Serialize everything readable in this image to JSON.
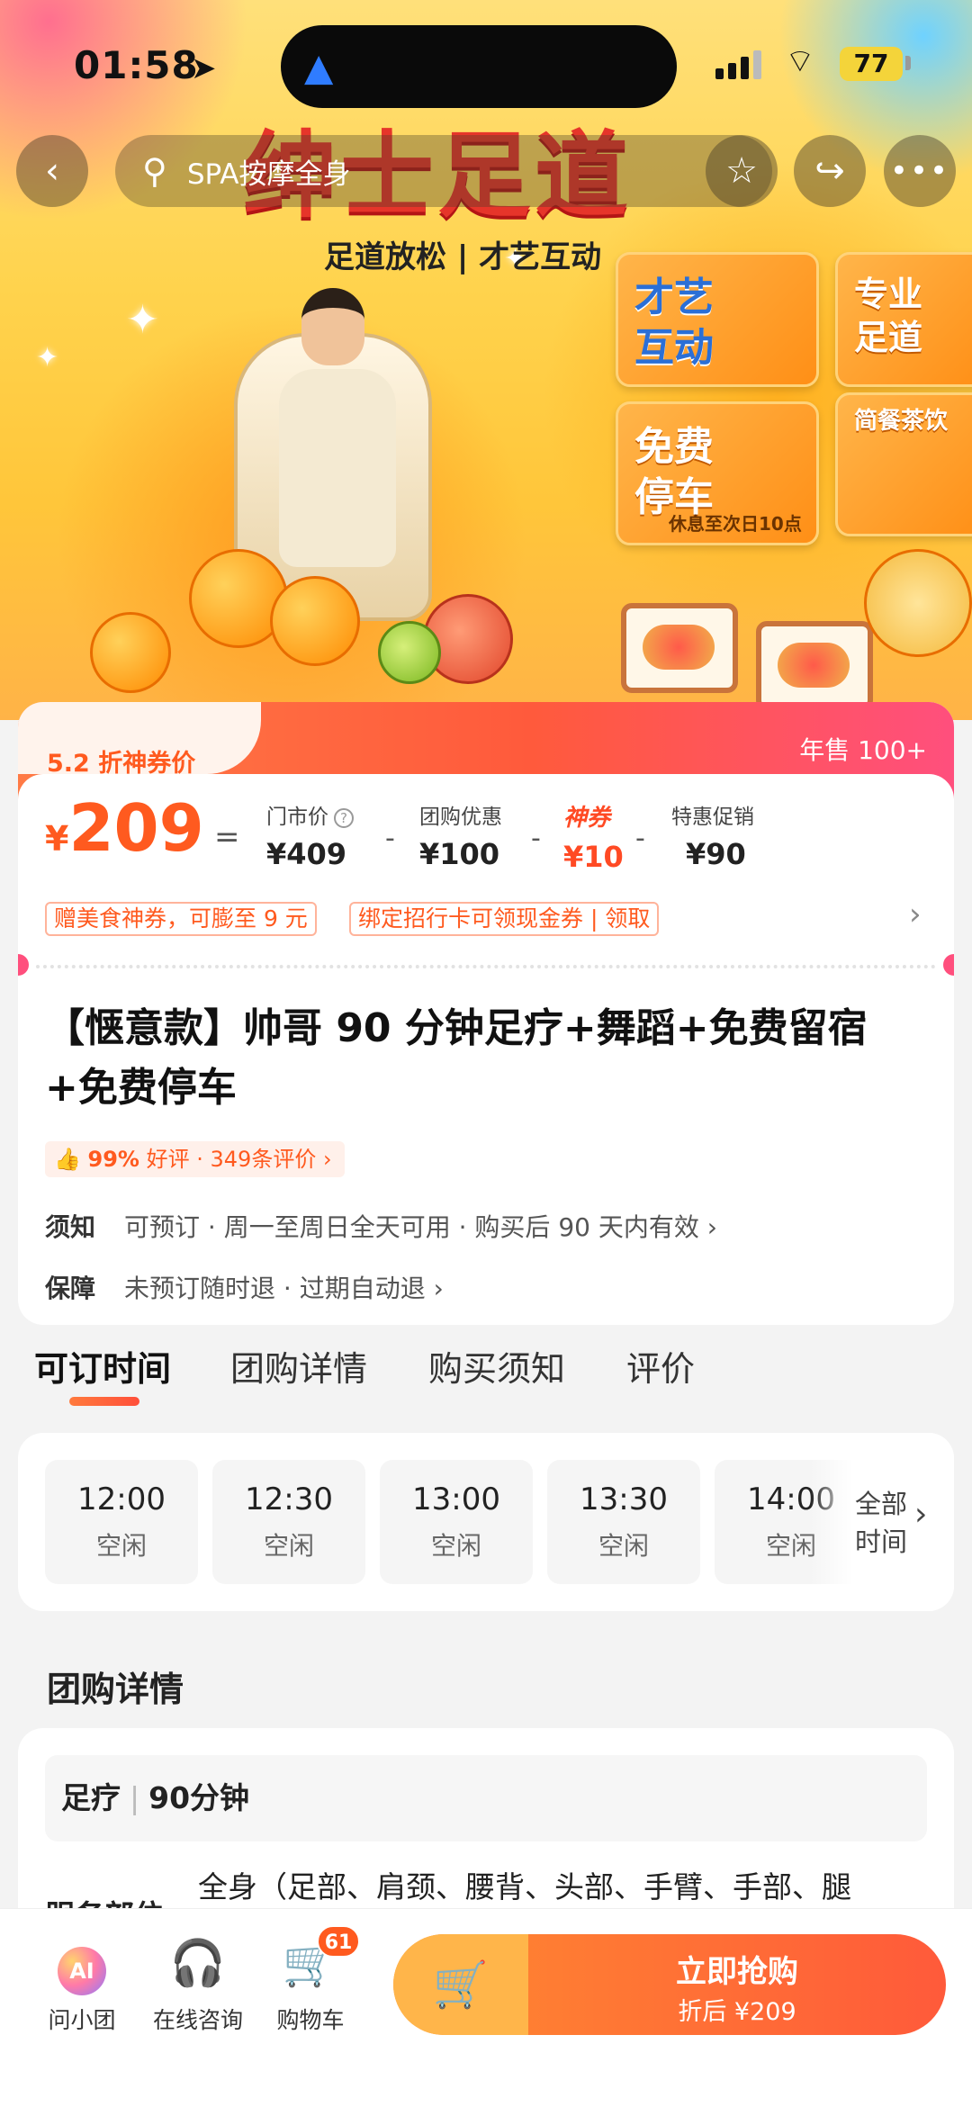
{
  "status_bar": {
    "time": "01:58",
    "battery": "77"
  },
  "top_nav": {
    "search_placeholder": "SPA按摩全身"
  },
  "hero": {
    "title": "绅士足道",
    "subtitle": "足道放松 | 才艺互动",
    "tiles": [
      {
        "text": "才艺\n互动"
      },
      {
        "text": "专业\n足道"
      },
      {
        "text": "免费\n停车",
        "note": "休息至次日10点"
      },
      {
        "text": "简餐茶饮"
      }
    ]
  },
  "price_card": {
    "discount_tag": "5.2 折神券价",
    "annual_sales": "年售 100+",
    "currency": "¥",
    "final_price": "209",
    "equals": "=",
    "breakdown": [
      {
        "label": "门市价",
        "value": "¥409"
      },
      {
        "label": "团购优惠",
        "value": "¥100"
      },
      {
        "label": "神券",
        "value": "¥10"
      },
      {
        "label": "特惠促销",
        "value": "¥90"
      }
    ],
    "promos": [
      "赠美食神券，可膨至 9 元",
      "绑定招行卡可领现金券 | 领取"
    ]
  },
  "deal": {
    "title": "【惬意款】帅哥 90 分钟足疗+舞蹈+免费留宿+免费停车",
    "rating": {
      "percent": "99%",
      "text": "好评 · 349条评价"
    },
    "notice": {
      "key": "须知",
      "value": "可预订 · 周一至周日全天可用 · 购买后 90 天内有效"
    },
    "guarantee": {
      "key": "保障",
      "value": "未预订随时退 · 过期自动退"
    }
  },
  "tabs": [
    "可订时间",
    "团购详情",
    "购买须知",
    "评价"
  ],
  "time_slots": [
    {
      "time": "12:00",
      "status": "空闲"
    },
    {
      "time": "12:30",
      "status": "空闲"
    },
    {
      "time": "13:00",
      "status": "空闲"
    },
    {
      "time": "13:30",
      "status": "空闲"
    },
    {
      "time": "14:00",
      "status": "空闲"
    }
  ],
  "all_time_label": "全部时间",
  "details": {
    "section_title": "团购详情",
    "package_name": "足疗",
    "package_duration": "90分钟",
    "service_label": "服务部位",
    "service_value": "全身（足部、肩颈、腰背、头部、手臂、手部、腿"
  },
  "bottom_bar": {
    "items": [
      {
        "label": "问小团",
        "icon": "ai-assistant-icon"
      },
      {
        "label": "在线咨询",
        "icon": "headset-icon"
      },
      {
        "label": "购物车",
        "icon": "cart-icon",
        "badge": "61"
      }
    ],
    "buy": {
      "label": "立即抢购",
      "sub": "折后 ¥209"
    }
  }
}
